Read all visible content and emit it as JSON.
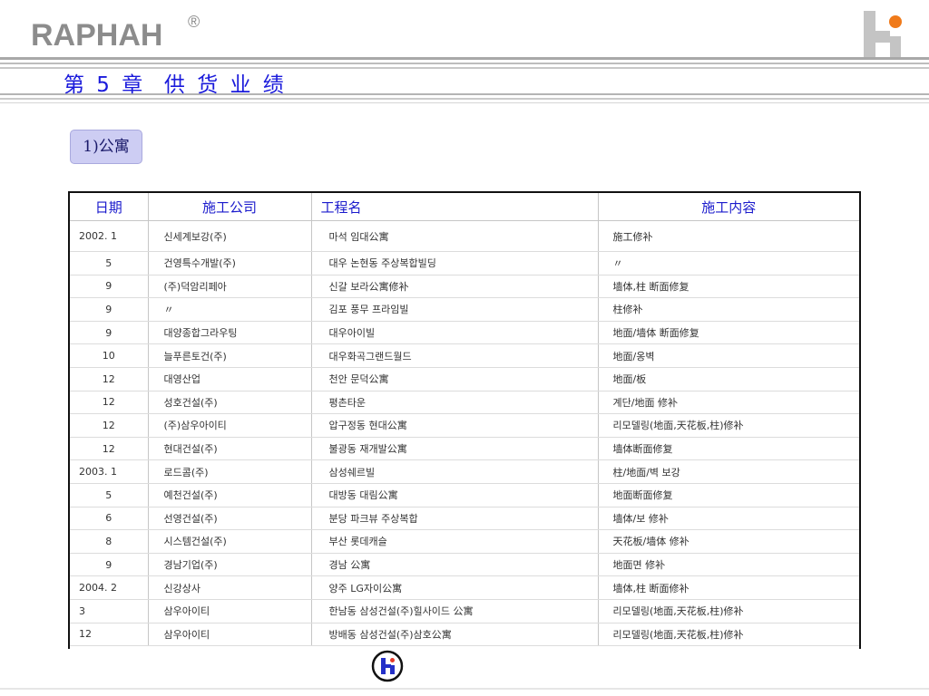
{
  "brand": {
    "name": "RAPHAH",
    "registered": "®"
  },
  "chapter_title": "第 5 章  供 货 业 绩",
  "section_label": "1)公寓",
  "colors": {
    "accent_blue": "#1a1adb",
    "logo_orange": "#f07a1a",
    "pill_bg": "#cdcdf3"
  },
  "icons": {
    "header_logo": "hi-logo-icon",
    "footer_logo": "hi-circle-logo-icon"
  },
  "table": {
    "headers": [
      "日期",
      "施工公司",
      "工程名",
      "施工内容"
    ],
    "rows": [
      {
        "date": "2002. 1",
        "company": "신세계보강(주)",
        "project": "마석 임대公寓",
        "content": "施工修补"
      },
      {
        "date": "5",
        "company": "건영특수개발(주)",
        "project": "대우 논현동 주상복합빌딩",
        "content": "  〃"
      },
      {
        "date": "9",
        "company": "(주)덕암리페아",
        "project": "신갈 보라公寓修补",
        "content": "墙体,柱 断面修复"
      },
      {
        "date": "9",
        "company": "  〃",
        "project": "김포 풍무 프라임빌",
        "content": "柱修补"
      },
      {
        "date": "9",
        "company": "대양종합그라우팅",
        "project": "대우아이빌",
        "content": "地面/墙体 断面修复"
      },
      {
        "date": "10",
        "company": "늘푸른토건(주)",
        "project": "대우화곡그랜드월드",
        "content": "地面/옹벽"
      },
      {
        "date": "12",
        "company": "대영산업",
        "project": "천안 문덕公寓",
        "content": "地面/板"
      },
      {
        "date": "12",
        "company": "성호건설(주)",
        "project": "평촌타운",
        "content": "계단/地面 修补"
      },
      {
        "date": "12",
        "company": "(주)삼우아이티",
        "project": "압구정동 현대公寓",
        "content": "리모델링(地面,天花板,柱)修补"
      },
      {
        "date": "12",
        "company": "현대건설(주)",
        "project": "불광동 재개발公寓",
        "content": "墙体断面修复"
      },
      {
        "date": "2003. 1",
        "company": "로드콤(주)",
        "project": "삼성쉐르빌",
        "content": "柱/地面/벽 보강"
      },
      {
        "date": "5",
        "company": "예천건설(주)",
        "project": "대방동 대림公寓",
        "content": "地面断面修复"
      },
      {
        "date": "6",
        "company": "선영건설(주)",
        "project": "분당 파크뷰 주상복합",
        "content": "墙体/보 修补"
      },
      {
        "date": "8",
        "company": "시스템건설(주)",
        "project": "부산 롯데캐슬",
        "content": "天花板/墙体 修补"
      },
      {
        "date": "9",
        "company": "경남기업(주)",
        "project": "경남 公寓",
        "content": "地面면 修补"
      },
      {
        "date": "2004. 2",
        "company": "신강상사",
        "project": "양주 LG자이公寓",
        "content": "墙体,柱 断面修补"
      },
      {
        "date": "3",
        "company": "삼우아이티",
        "project": "한남동 삼성건설(주)힐사이드 公寓",
        "content": "리모델링(地面,天花板,柱)修补"
      },
      {
        "date": "12",
        "company": "삼우아이티",
        "project": "방배동 삼성건설(주)삼호公寓",
        "content": "리모델링(地面,天花板,柱)修补"
      }
    ]
  }
}
